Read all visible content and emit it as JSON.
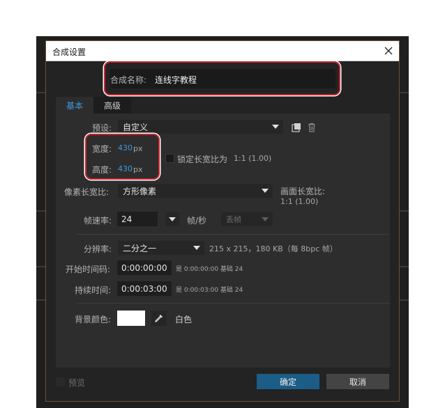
{
  "dialog": {
    "title": "合成设置"
  },
  "comp_name": {
    "label": "合成名称:",
    "value": "连线字教程"
  },
  "tabs": [
    {
      "label": "基本"
    },
    {
      "label": "高级"
    }
  ],
  "preset": {
    "label": "预设:",
    "value": "自定义"
  },
  "width": {
    "label": "宽度:",
    "value": "430",
    "unit": "px"
  },
  "height": {
    "label": "高度:",
    "value": "430",
    "unit": "px"
  },
  "lock_aspect": {
    "label": "锁定长宽比为",
    "ratio": "1:1 (1.00)"
  },
  "pixel_aspect": {
    "label": "像素长宽比:",
    "value": "方形像素"
  },
  "frame_aspect": {
    "label": "画面长宽比:",
    "value": "1:1 (1.00)"
  },
  "frame_rate": {
    "label": "帧速率:",
    "value": "24",
    "unit": "帧/秒",
    "drop_frame": "丢帧"
  },
  "resolution": {
    "label": "分辨率:",
    "value": "二分之一",
    "info": "215 x 215，180 KB（每 8bpc 帧）"
  },
  "start_timecode": {
    "label": "开始时间码:",
    "value": "0:00:00:00",
    "note": "是 0:00:00:00  基础 24"
  },
  "duration": {
    "label": "持续时间:",
    "value": "0:00:03:00",
    "note": "是 0:00:03:00  基础 24"
  },
  "background": {
    "label": "背景颜色:",
    "color_name": "白色",
    "color": "#ffffff"
  },
  "footer": {
    "preview_label": "预览",
    "ok_label": "确定",
    "cancel_label": "取消"
  }
}
